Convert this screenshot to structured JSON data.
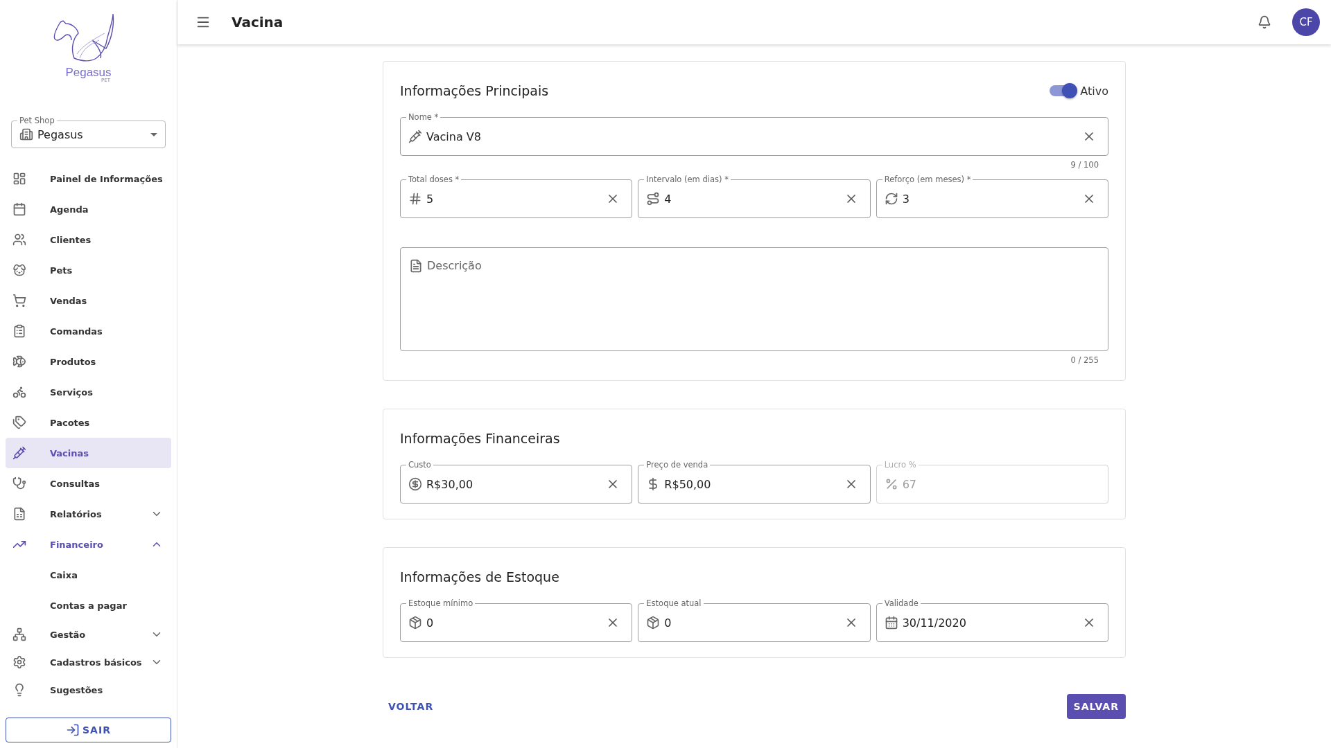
{
  "logo": {
    "name": "Pegasus",
    "tagline": "PET"
  },
  "shop_select": {
    "label": "Pet Shop",
    "value": "Pegasus"
  },
  "nav": {
    "items": [
      {
        "label": "Painel de Informações",
        "selected": false
      },
      {
        "label": "Agenda",
        "selected": false
      },
      {
        "label": "Clientes",
        "selected": false
      },
      {
        "label": "Pets",
        "selected": false
      },
      {
        "label": "Vendas",
        "selected": false
      },
      {
        "label": "Comandas",
        "selected": false
      },
      {
        "label": "Produtos",
        "selected": false
      },
      {
        "label": "Serviços",
        "selected": false
      },
      {
        "label": "Pacotes",
        "selected": false
      },
      {
        "label": "Vacinas",
        "selected": true
      },
      {
        "label": "Consultas",
        "selected": false
      },
      {
        "label": "Relatórios",
        "selected": false,
        "expanded": false
      },
      {
        "label": "Financeiro",
        "selected": false,
        "expanded": true,
        "children": [
          {
            "label": "Caixa",
            "selected": false
          },
          {
            "label": "Contas a pagar",
            "selected": false
          }
        ]
      },
      {
        "label": "Gestão",
        "selected": false,
        "expanded": false
      },
      {
        "label": "Cadastros básicos",
        "selected": false,
        "expanded": false
      },
      {
        "label": "Sugestões",
        "selected": false
      }
    ]
  },
  "logout_button": "SAIR",
  "header": {
    "title": "Vacina",
    "avatar": "CF"
  },
  "sections": [
    {
      "title": "Informações Principais",
      "toggle": {
        "label": "Ativo",
        "on": true
      },
      "name_field": {
        "label": "Nome *",
        "value": "Vacina V8",
        "counter": "9 / 100",
        "disabled": false
      },
      "fields": [
        {
          "label": "Total doses *",
          "value": "5",
          "disabled": false
        },
        {
          "label": "Intervalo (em dias) *",
          "value": "4",
          "disabled": false
        },
        {
          "label": "Reforço (em meses) *",
          "value": "3",
          "disabled": false
        }
      ],
      "description": {
        "placeholder": "Descrição",
        "counter": "0 / 255"
      }
    },
    {
      "title": "Informações Financeiras",
      "fields": [
        {
          "label": "Custo",
          "value": "R$30,00",
          "disabled": false
        },
        {
          "label": "Preço de venda",
          "value": "R$50,00",
          "disabled": false
        },
        {
          "label": "Lucro %",
          "value": "67",
          "disabled": true
        }
      ]
    },
    {
      "title": "Informações de Estoque",
      "fields": [
        {
          "label": "Estoque mínimo",
          "value": "0",
          "disabled": false
        },
        {
          "label": "Estoque atual",
          "value": "0",
          "disabled": false
        },
        {
          "label": "Validade",
          "value": "30/11/2020",
          "disabled": false
        }
      ]
    }
  ],
  "actions": {
    "back": "VOLTAR",
    "save": "SALVAR"
  }
}
